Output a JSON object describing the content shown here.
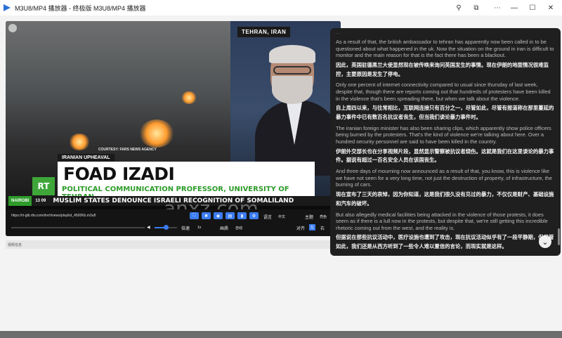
{
  "window": {
    "title": "M3U8/MP4 播放器 - 终极版 M3U8/MP4 播放器",
    "buttons": [
      "pin-icon",
      "extensions-icon",
      "minimize-icon",
      "maximize-icon",
      "close-icon"
    ]
  },
  "video": {
    "location_badge": "TEHRAN, IRAN",
    "courtesy": "COURTESY: FARS NEWS AGENCY",
    "section": "IRANIAN UPHEAVAL",
    "name": "FOAD IZADI",
    "role": "POLITICAL COMMUNICATION PROFESSOR, UNIVERSITY OF TEHRAN",
    "logo": "RT",
    "ticker_city": "NAIROBI",
    "ticker_time": "13 09",
    "ticker_headline": "MUSLIM STATES DENOUNCE ISRAELI RECOGNITION OF SOMALILAND",
    "watermark": "anxz.com"
  },
  "controls": {
    "url": "https://rt-glb.rttv.com/dvr/rtnews/playlist_4500Kb.m3u8",
    "language_label": "语言",
    "language_value": "中文",
    "theme_label": "主题",
    "theme_value": "亮色",
    "speed_label": "倍速",
    "speed_value": "1x",
    "quality_label": "画质",
    "quality_value": "自动",
    "align_label": "对齐",
    "align_btn": "左",
    "align_btn2": "右",
    "volume_level": 0.55
  },
  "status": {
    "left": "视频信息",
    "right": "状态"
  },
  "transcript": {
    "top_line": "...",
    "entries": [
      {
        "en": "As a result of that, the british ambassador to tehran has apparently now been called in to be questioned about what happened in the uk. Now the situation on the ground in iran is difficult to monitor and the main reason for that is the fact there has been a blackout.",
        "zh": "因此，英国驻德黑兰大使显然现在被传唤来询问英国发生的事情。现在伊朗的地面情况很难监控，主要原因是发生了停电。"
      },
      {
        "en": "Only one percent of internet connectivity compared to usual since thursday of last week, despite that, though there are reports coming out that hundreds of protesters have been killed in the violence that's been spreading there, but when we talk about the violence.",
        "zh": "自上周四以来，与往常相比，互联网连接只有百分之一，尽管如此，尽管有报道称在那里蔓延的暴力事件中已有数百名抗议者丧生，但当我们谈论暴力事件时。"
      },
      {
        "en": "The iranian foreign minister has also been sharing clips, which apparently show police officers being burned by the protesters. That's the kind of violence we're talking about here. Over a hundred security personnel are said to have been killed in the country.",
        "zh": "伊朗外交部长也在分享视频片段，显然显示警察被抗议者烧伤。这就是我们在这里谈论的暴力事件。据说有超过一百名安全人员在该国丧生。"
      },
      {
        "en": "And three days of mourning now announced as a result of that, you know, this is violence like we have not seen for a very long time, not just the destruction of property, of infrastructure, the burning of cars.",
        "zh": "现在宣布了三天的哀悼，因为你知道，这是我们很久没有见过的暴力，不仅仅是财产、基础设施和汽车的破坏。"
      },
      {
        "en": "But also allegedly medical facilities being attacked in the violence of those protests, it does seem as if there is a lull now in the protests, but despite that, we're still getting this incredible rhetoric coming out from the west, and the reality is.",
        "zh": "但据说在那些抗议活动中，医疗设施也遭到了攻击，现在抗议活动似乎有了一段平静期，但尽管如此，我们还是从西方听到了一些令人难以置信的言论，而现实就是这样。"
      }
    ]
  }
}
